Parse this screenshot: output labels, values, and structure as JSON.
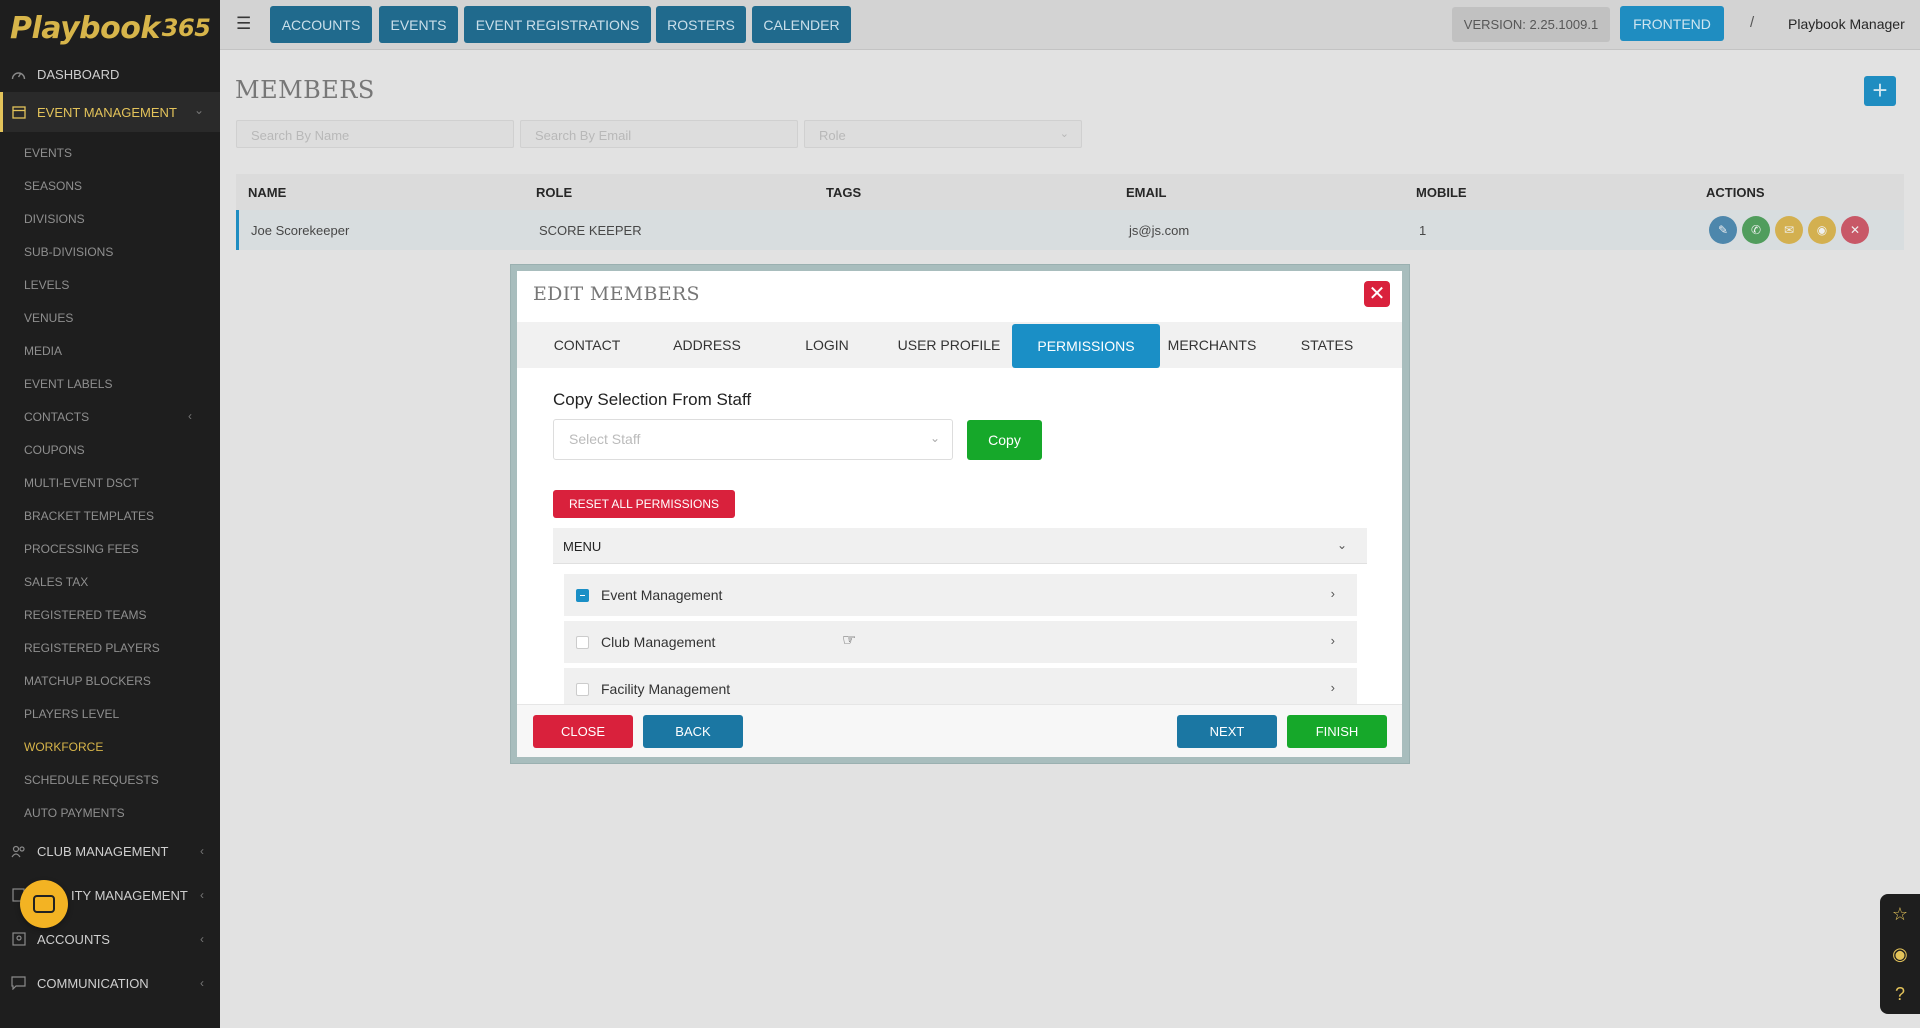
{
  "app": {
    "logo_main": "Playbook",
    "logo_suffix": "365"
  },
  "sidebar": {
    "items": [
      {
        "label": "DASHBOARD",
        "icon": "gauge-icon",
        "type": "main"
      },
      {
        "label": "EVENT MANAGEMENT",
        "icon": "calendar-icon",
        "type": "main",
        "active": true
      },
      {
        "label": "EVENTS",
        "type": "sub"
      },
      {
        "label": "SEASONS",
        "type": "sub"
      },
      {
        "label": "DIVISIONS",
        "type": "sub"
      },
      {
        "label": "SUB-DIVISIONS",
        "type": "sub"
      },
      {
        "label": "LEVELS",
        "type": "sub"
      },
      {
        "label": "VENUES",
        "type": "sub"
      },
      {
        "label": "MEDIA",
        "type": "sub"
      },
      {
        "label": "EVENT LABELS",
        "type": "sub"
      },
      {
        "label": "CONTACTS",
        "type": "sub"
      },
      {
        "label": "COUPONS",
        "type": "sub"
      },
      {
        "label": "MULTI-EVENT DSCT",
        "type": "sub"
      },
      {
        "label": "BRACKET TEMPLATES",
        "type": "sub"
      },
      {
        "label": "PROCESSING FEES",
        "type": "sub"
      },
      {
        "label": "SALES TAX",
        "type": "sub"
      },
      {
        "label": "REGISTERED TEAMS",
        "type": "sub"
      },
      {
        "label": "REGISTERED PLAYERS",
        "type": "sub"
      },
      {
        "label": "MATCHUP BLOCKERS",
        "type": "sub"
      },
      {
        "label": "PLAYERS LEVEL",
        "type": "sub"
      },
      {
        "label": "WORKFORCE",
        "type": "sub",
        "highlight": true
      },
      {
        "label": "SCHEDULE REQUESTS",
        "type": "sub"
      },
      {
        "label": "AUTO PAYMENTS",
        "type": "sub"
      },
      {
        "label": "CLUB MANAGEMENT",
        "icon": "people-icon",
        "type": "main"
      },
      {
        "label": "ITY MANAGEMENT",
        "icon": "building-icon",
        "type": "main"
      },
      {
        "label": "ACCOUNTS",
        "icon": "user-card-icon",
        "type": "main"
      },
      {
        "label": "COMMUNICATION",
        "icon": "chat-icon",
        "type": "main"
      }
    ]
  },
  "topbar": {
    "nav": [
      "ACCOUNTS",
      "EVENTS",
      "EVENT REGISTRATIONS",
      "ROSTERS",
      "CALENDER"
    ],
    "version": "VERSION: 2.25.1009.1",
    "frontend": "FRONTEND",
    "separator": "/",
    "user": "Playbook Manager"
  },
  "page": {
    "title": "MEMBERS",
    "add_label": "+",
    "filters": {
      "name_placeholder": "Search By Name",
      "email_placeholder": "Search By Email",
      "role_placeholder": "Role"
    },
    "table": {
      "headers": [
        "NAME",
        "ROLE",
        "TAGS",
        "EMAIL",
        "MOBILE",
        "ACTIONS"
      ],
      "rows": [
        {
          "name": "Joe Scorekeeper",
          "role": "SCORE KEEPER",
          "tags": "",
          "email": "js@js.com",
          "mobile": "1"
        }
      ]
    }
  },
  "modal": {
    "title": "EDIT MEMBERS",
    "tabs": [
      "CONTACT",
      "ADDRESS",
      "LOGIN",
      "USER PROFILE",
      "PERMISSIONS",
      "MERCHANTS",
      "STATES"
    ],
    "active_tab": "PERMISSIONS",
    "copy_label": "Copy Selection From Staff",
    "staff_placeholder": "Select Staff",
    "copy_button": "Copy",
    "reset_button": "RESET ALL PERMISSIONS",
    "accordion_title": "MENU",
    "permission_items": [
      {
        "label": "Event Management",
        "state": "partial"
      },
      {
        "label": "Club Management",
        "state": "unchecked"
      },
      {
        "label": "Facility Management",
        "state": "unchecked"
      }
    ],
    "footer": {
      "close": "CLOSE",
      "back": "BACK",
      "next": "NEXT",
      "finish": "FINISH"
    }
  },
  "colors": {
    "primary": "#1a8fc6",
    "danger": "#d9213c",
    "success": "#16a82a",
    "accent": "#e3c35a"
  }
}
